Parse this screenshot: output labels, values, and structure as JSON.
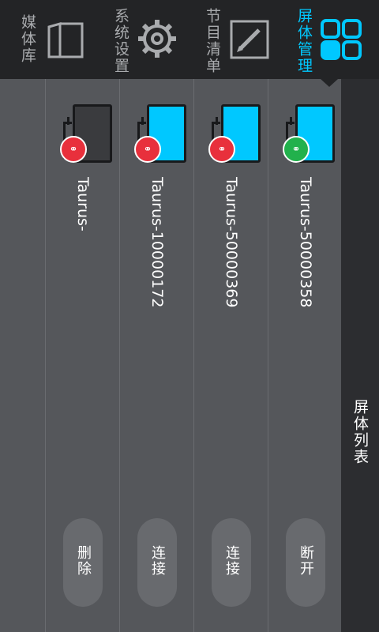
{
  "nav": {
    "items": [
      {
        "label": "屏体管理",
        "icon": "grid-icon",
        "active": true
      },
      {
        "label": "节目清单",
        "icon": "edit-icon",
        "active": false
      },
      {
        "label": "系统设置",
        "icon": "gear-icon",
        "active": false
      },
      {
        "label": "媒体库",
        "icon": "folder-icon",
        "active": false
      }
    ],
    "active_color": "#00c8ff"
  },
  "side_title": "屏体列表",
  "devices": [
    {
      "name": "Taurus-50000358",
      "status": "connected",
      "action": "断开",
      "screen_color": "#00c8ff",
      "dot_color": "#22b14c"
    },
    {
      "name": "Taurus-50000369",
      "status": "disconnected",
      "action": "连接",
      "screen_color": "#00c8ff",
      "dot_color": "#e8303c"
    },
    {
      "name": "Taurus-10000172",
      "status": "disconnected",
      "action": "连接",
      "screen_color": "#00c8ff",
      "dot_color": "#e8303c"
    },
    {
      "name": "Taurus-",
      "status": "disconnected",
      "action": "删除",
      "screen_color": "#3a3b3e",
      "dot_color": "#e8303c"
    }
  ]
}
